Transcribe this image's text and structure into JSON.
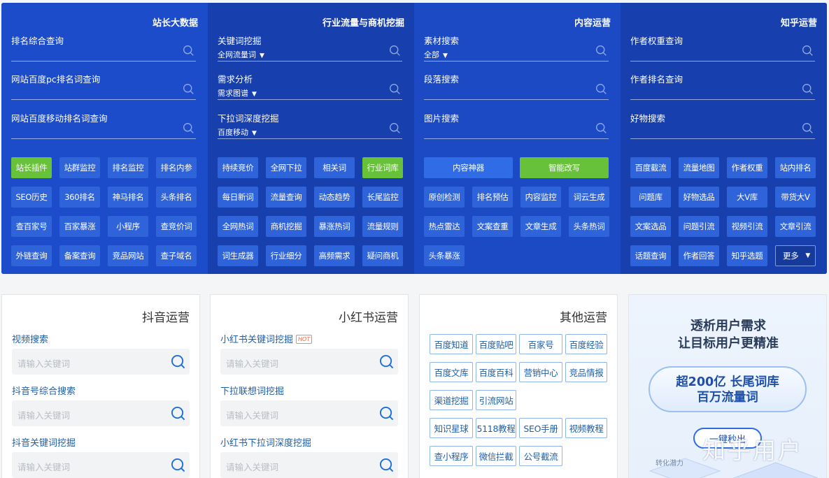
{
  "columns": [
    {
      "title": "站长大数据",
      "searches": [
        {
          "label": "排名综合查询",
          "sub": ""
        },
        {
          "label": "网站百度pc排名词查询",
          "sub": ""
        },
        {
          "label": "网站百度移动排名词查询",
          "sub": ""
        }
      ],
      "buttons": [
        "站长插件",
        "站群监控",
        "排名监控",
        "排名内参",
        "SEO历史",
        "360排名",
        "神马排名",
        "头条排名",
        "查百家号",
        "百家暴涨",
        "小程序",
        "查竞价词",
        "外链查询",
        "备案查询",
        "竞品网站",
        "查子域名"
      ]
    },
    {
      "title": "行业流量与商机挖掘",
      "searches": [
        {
          "label": "关键词挖掘",
          "sub": "全网流量词"
        },
        {
          "label": "需求分析",
          "sub": "需求图谱"
        },
        {
          "label": "下拉词深度挖掘",
          "sub": "百度移动"
        }
      ],
      "buttons": [
        "持续竞价",
        "全网下拉",
        "相关词",
        "行业词库",
        "每日新词",
        "流量查询",
        "动态趋势",
        "长尾监控",
        "全网热词",
        "商机挖掘",
        "暴涨热词",
        "流量规则",
        "词生成器",
        "行业细分",
        "高频需求",
        "疑问商机"
      ]
    },
    {
      "title": "内容运营",
      "searches": [
        {
          "label": "素材搜索",
          "sub": "全部"
        },
        {
          "label": "段落搜索",
          "sub": ""
        },
        {
          "label": "图片搜索",
          "sub": ""
        }
      ],
      "buttons": [
        "内容神器",
        "智能改写",
        "原创检测",
        "排名预估",
        "内容监控",
        "词云生成",
        "热点雷达",
        "文案查重",
        "文章生成",
        "头条热词",
        "头条暴涨"
      ]
    },
    {
      "title": "知乎运营",
      "searches": [
        {
          "label": "作者权重查询",
          "sub": ""
        },
        {
          "label": "作者排名查询",
          "sub": ""
        },
        {
          "label": "好物搜索",
          "sub": ""
        }
      ],
      "buttons": [
        "百度截流",
        "流量地图",
        "作者权重",
        "站内排名",
        "问题库",
        "好物选品",
        "大V库",
        "带货大V",
        "文案选品",
        "问题引流",
        "视频引流",
        "文章引流",
        "话题查询",
        "作者回答",
        "知乎选题",
        "更多"
      ]
    }
  ],
  "douyin": {
    "title": "抖音运营",
    "fields": [
      {
        "label": "视频搜索",
        "placeholder": "请输入关键词"
      },
      {
        "label": "抖音号综合搜索",
        "placeholder": "请输入关键词"
      },
      {
        "label": "抖音关键词挖掘",
        "placeholder": "请输入关键词"
      }
    ]
  },
  "xhs": {
    "title": "小红书运营",
    "hot": "HOT",
    "fields": [
      {
        "label": "小红书关键词挖掘",
        "placeholder": "请输入关键词"
      },
      {
        "label": "下拉联想词挖掘",
        "placeholder": "请输入关键词"
      },
      {
        "label": "小红书下拉词深度挖掘",
        "placeholder": "请输入关键词"
      }
    ]
  },
  "other": {
    "title": "其他运营",
    "tags": [
      "百度知道",
      "百度贴吧",
      "百家号",
      "百度经验",
      "百度文库",
      "百度百科",
      "营销中心",
      "竞品情报",
      "渠道挖掘",
      "引流网站",
      "知识星球",
      "5118教程",
      "SEO手册",
      "视频教程",
      "查小程序",
      "微信拦截",
      "公号截流"
    ]
  },
  "promo": {
    "line1": "透析用户需求",
    "line2": "让目标用户更精准",
    "pill1": "超200亿 长尾词库",
    "pill2": "百万流量词",
    "cta": "一键秒出",
    "deco": "转化潜力"
  },
  "watermark": "知乎用户",
  "colors": {
    "primary": "#1d4ccb",
    "green": "#67c23a",
    "link": "#1f5fa8"
  }
}
